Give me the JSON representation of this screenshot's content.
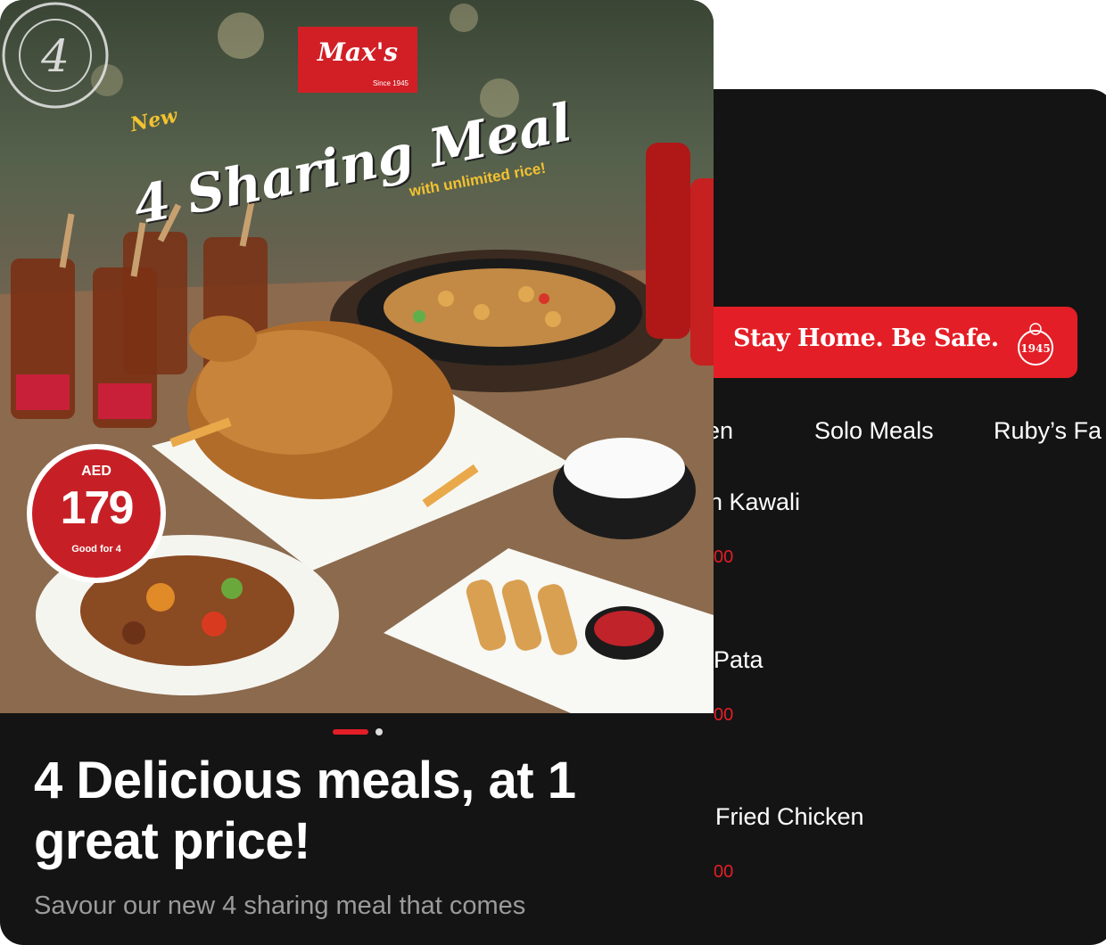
{
  "menu_screen": {
    "banner_text": "Stay Home. Be Safe.",
    "seal_text": "1945",
    "tabs": [
      {
        "label": "en"
      },
      {
        "label": "Solo Meals"
      },
      {
        "label": "Ruby’s Fa"
      }
    ],
    "items": [
      {
        "name": "n Kawali",
        "price": "00"
      },
      {
        "name": "Pata",
        "price": "00"
      },
      {
        "name": "Fried Chicken",
        "price": "00"
      }
    ]
  },
  "promo_screen": {
    "brand": {
      "name": "Max's",
      "since": "Since 1945"
    },
    "hero": {
      "badge_new": "New",
      "title": "4 Sharing Meal",
      "subtitle": "with unlimited rice!",
      "stamp_number": "4",
      "price": {
        "currency": "AED",
        "amount": "179",
        "note": "Good for 4"
      }
    },
    "carousel": {
      "current": 1,
      "total": 2
    },
    "headline": "4 Delicious meals, at 1 great price!",
    "description": "Savour our new 4 sharing meal that comes"
  },
  "colors": {
    "accent": "#e41e26",
    "background": "#141414",
    "text": "#ffffff"
  }
}
